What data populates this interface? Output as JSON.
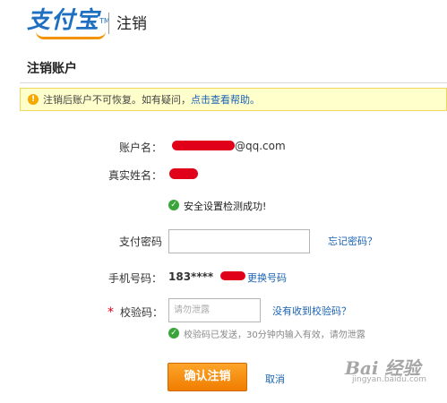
{
  "header": {
    "logo_text": "支付宝",
    "logo_tm": "TM",
    "title": "注销"
  },
  "page": {
    "title": "注销账户"
  },
  "notice": {
    "text": "注销后账户不可恢复。如有疑问，",
    "link": "点击查看帮助。"
  },
  "form": {
    "account_label": "账户名：",
    "account_value": "@qq.com",
    "realname_label": "真实姓名：",
    "security_msg": "安全设置检测成功!",
    "paypwd_label": "支付密码",
    "forgot_link": "忘记密码？",
    "phone_label": "手机号码：",
    "phone_value": "183****",
    "change_phone_link": "更换号码",
    "code_star": "*",
    "code_label": "校验码：",
    "code_placeholder": "请勿泄露",
    "no_code_link": "没有收到校验码？",
    "sent_msg": "校验码已发送，30分钟内输入有效，请勿泄露"
  },
  "actions": {
    "confirm_label": "确认注销",
    "cancel_label": "取消"
  },
  "watermark": {
    "logo": "Bai 经验",
    "url": "jingyan.baidu.com"
  },
  "colors": {
    "link": "#1a63b4",
    "notice_bg": "#ffffcc",
    "button": "#f07d00",
    "redaction": "#e0001a",
    "success": "#3aa53a"
  }
}
